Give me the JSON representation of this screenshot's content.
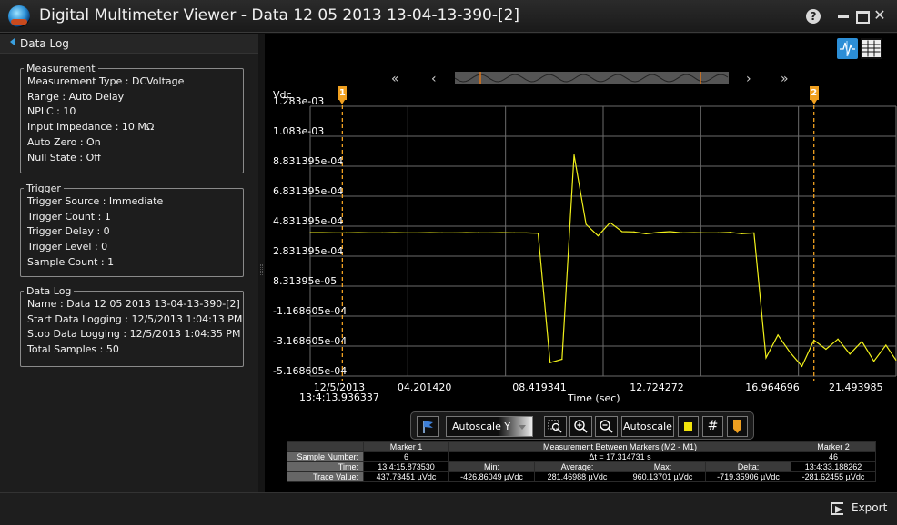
{
  "window": {
    "title": "Digital Multimeter Viewer - Data 12 05 2013 13-04-13-390-[2]",
    "help": "?",
    "close": "✕"
  },
  "left": {
    "header": "Data Log",
    "measurement": {
      "legend": "Measurement",
      "rows": [
        "Measurement Type :  DCVoltage",
        "Range :  Auto Delay",
        "NPLC :  10",
        "Input Impedance :  10 MΩ",
        "Auto Zero :  On",
        "Null State :  Off"
      ]
    },
    "trigger": {
      "legend": "Trigger",
      "rows": [
        "Trigger Source :  Immediate",
        "Trigger Count :  1",
        "Trigger Delay :  0",
        "Trigger Level :  0",
        "Sample Count :  1"
      ]
    },
    "datalog": {
      "legend": "Data Log",
      "rows": [
        "Name :  Data 12 05 2013 13-04-13-390-[2]",
        "Start Data Logging :  12/5/2013 1:04:13 PM",
        "Stop Data Logging :  12/5/2013 1:04:35 PM",
        "Total Samples :  50"
      ]
    }
  },
  "navigator": {
    "first": "«",
    "prev": "‹",
    "next": "›",
    "last": "»"
  },
  "chart_data": {
    "type": "line",
    "ylabel": "Vdc",
    "xlabel": "Time (sec)",
    "y_ticks": [
      "1.283e-03",
      "1.083e-03",
      "8.831395e-04",
      "6.831395e-04",
      "4.831395e-04",
      "2.831395e-04",
      "8.31395e-05",
      "-1.168605e-04",
      "-3.168605e-04",
      "-5.168605e-04"
    ],
    "ylim": [
      -0.0005168605,
      0.001283
    ],
    "x_ticks": [
      {
        "line1": "12/5/2013",
        "line2": "13:4:13.936337",
        "value": 0
      },
      {
        "line1": "04.201420",
        "value": 4.20142
      },
      {
        "line1": "08.419341",
        "value": 8.419341
      },
      {
        "line1": "12.724272",
        "value": 12.724272
      },
      {
        "line1": "16.964696",
        "value": 16.964696
      },
      {
        "line1": "21.493985",
        "value": 21.493985
      }
    ],
    "xlim": [
      0,
      21.493985
    ],
    "grid": true,
    "series": [
      {
        "color": "#f2f21a",
        "x": [
          0,
          0.44,
          0.88,
          1.32,
          1.76,
          2.2,
          2.64,
          3.08,
          3.52,
          3.96,
          4.4,
          4.84,
          5.28,
          5.72,
          6.16,
          6.6,
          7.04,
          7.48,
          7.92,
          8.36,
          8.8,
          9.24,
          9.68,
          10.12,
          10.56,
          11.0,
          11.44,
          11.88,
          12.32,
          12.76,
          13.2,
          13.64,
          14.08,
          14.52,
          14.96,
          15.4,
          15.84,
          16.28,
          16.72,
          17.16,
          17.6,
          18.04,
          18.48,
          18.92,
          19.36,
          19.8,
          20.24,
          20.68,
          21.12,
          21.49
        ],
        "y": [
          0.00044,
          0.00044,
          0.000438,
          0.000439,
          0.00044,
          0.000438,
          0.000439,
          0.00044,
          0.000438,
          0.000439,
          0.00044,
          0.000439,
          0.000438,
          0.00044,
          0.000439,
          0.000438,
          0.00044,
          0.000439,
          0.000438,
          0.000436,
          -0.000427,
          -0.000405,
          0.000958,
          0.000495,
          0.000419,
          0.000507,
          0.000447,
          0.000445,
          0.000432,
          0.000441,
          0.000447,
          0.000439,
          0.00044,
          0.000438,
          0.000439,
          0.000442,
          0.000433,
          0.000438,
          -0.000395,
          -0.000243,
          -0.000358,
          -0.000452,
          -0.000277,
          -0.000338,
          -0.00027,
          -0.00037,
          -0.000286,
          -0.000418,
          -0.000311,
          -0.00041
        ]
      }
    ],
    "markers": [
      {
        "label": "1",
        "x": 1.18,
        "color": "#f0a020"
      },
      {
        "label": "2",
        "x": 18.48,
        "color": "#f0a020"
      }
    ]
  },
  "toolbar": {
    "autoscale_y": "Autoscale Y",
    "autoscale": "Autoscale",
    "grid": "#"
  },
  "marker_table": {
    "headers": [
      "",
      "Marker 1",
      "Measurement Between Markers (M2 - M1)",
      "Marker 2"
    ],
    "sample_number": {
      "label": "Sample Number:",
      "m1": "6",
      "delta_t": "Δt = 17.314731 s",
      "m2": "46"
    },
    "time": {
      "label": "Time:",
      "m1": "13:4:15.873530",
      "stats": [
        "Min:",
        "Average:",
        "Max:",
        "Delta:"
      ],
      "m2": "13:4:33.188262"
    },
    "trace": {
      "label": "Trace Value:",
      "m1": "437.73451 µVdc",
      "stats": [
        "-426.86049 µVdc",
        "281.46988 µVdc",
        "960.13701 µVdc",
        "-719.35906 µVdc"
      ],
      "m2": "-281.62455 µVdc"
    }
  },
  "bottom": {
    "export": "Export"
  }
}
